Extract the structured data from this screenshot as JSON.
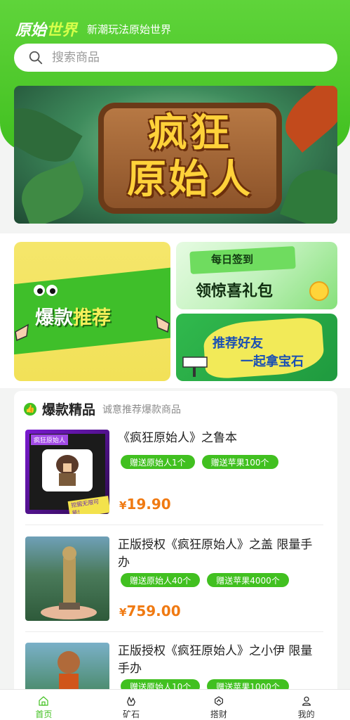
{
  "header": {
    "brand_logo_part1": "原始",
    "brand_logo_part2": "世界",
    "slogan": "新潮玩法原始世界"
  },
  "search": {
    "placeholder": "搜索商品"
  },
  "banner": {
    "line1": "疯狂",
    "line2": "原始人"
  },
  "promos": {
    "featured": {
      "part1": "爆款",
      "part2": "推荐"
    },
    "checkin": {
      "line1": "每日签到",
      "line2": "领惊喜礼包"
    },
    "invite": {
      "line1": "推荐好友",
      "line2": "一起拿宝石"
    }
  },
  "section": {
    "title": "爆款精品",
    "subtitle": "诚意推荐爆款商品"
  },
  "products": [
    {
      "name": "《疯狂原始人》之鲁本",
      "tags": [
        "赠送原始人1个",
        "赠送苹果100个"
      ],
      "currency": "¥",
      "price": "19.90",
      "thumb_caption": "疯狂原始人",
      "thumb_badge": "挖掘无限可能!"
    },
    {
      "name": "正版授权《疯狂原始人》之盖 限量手办",
      "tags": [
        "赠送原始人40个",
        "赠送苹果4000个"
      ],
      "currency": "¥",
      "price": "759.00"
    },
    {
      "name": "正版授权《疯狂原始人》之小伊 限量手办",
      "tags": [
        "赠送原始人10个",
        "赠送苹果1000个"
      ]
    }
  ],
  "tabbar": {
    "items": [
      {
        "label": "首页",
        "icon": "home-icon",
        "active": true
      },
      {
        "label": "矿石",
        "icon": "crystal-icon",
        "active": false
      },
      {
        "label": "搭财",
        "icon": "wealth-icon",
        "active": false
      },
      {
        "label": "我的",
        "icon": "profile-icon",
        "active": false
      }
    ]
  },
  "colors": {
    "brand_green": "#41c020",
    "price_orange": "#f07a12"
  }
}
